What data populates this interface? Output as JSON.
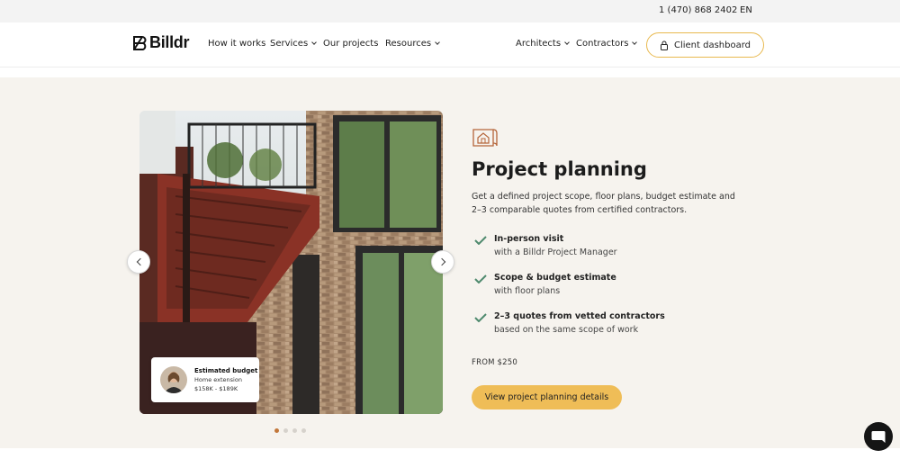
{
  "topbar": {
    "phone": "1 (470) 868 2402",
    "language": "EN"
  },
  "header": {
    "logo_text": "Billdr",
    "nav": {
      "how_it_works": "How it works",
      "services": "Services",
      "our_projects": "Our projects",
      "resources": "Resources",
      "architects": "Architects",
      "contractors": "Contractors"
    },
    "client_dashboard": "Client dashboard"
  },
  "carousel": {
    "budget_card": {
      "title": "Estimated budget",
      "project": "Home extension",
      "range": "$158K - $189K"
    },
    "slide_count": 4,
    "active_slide": 1
  },
  "content": {
    "title": "Project planning",
    "description": "Get a defined project scope, floor plans, budget estimate and 2–3 comparable quotes from certified contractors.",
    "features": [
      {
        "title": "In-person visit",
        "subtitle": "with a Billdr Project Manager"
      },
      {
        "title": "Scope & budget estimate",
        "subtitle": "with floor plans"
      },
      {
        "title": "2–3 quotes from vetted contractors",
        "subtitle": "based on the same scope of work"
      }
    ],
    "price": "FROM $250",
    "cta": "View project planning details"
  },
  "colors": {
    "accent": "#efbd57",
    "check": "#4f8a6e",
    "icon": "#b5653a",
    "section_bg": "#f6f3ee"
  }
}
